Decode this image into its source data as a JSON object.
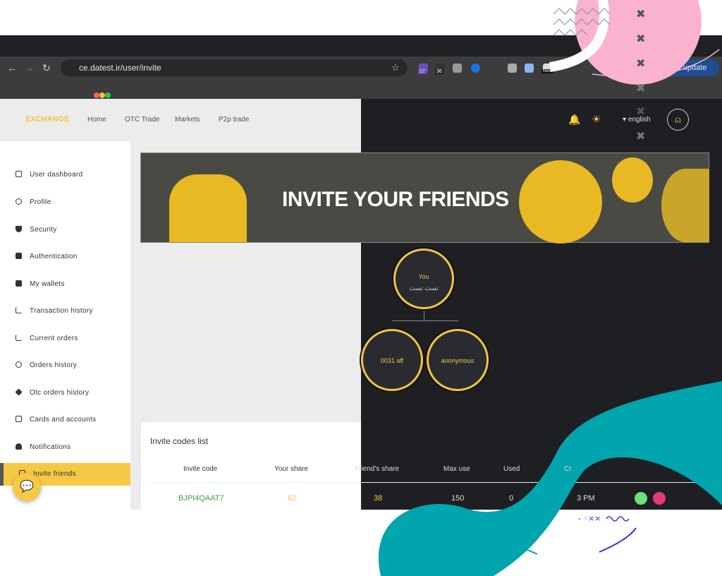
{
  "browser": {
    "url": "ce.datest.ir/user/invite",
    "relaunch": "Relaunch to update",
    "ext_badges": [
      "17",
      "36",
      "New"
    ]
  },
  "header": {
    "logo": "EXCHANGE",
    "menu": [
      "Home",
      "OTC Trade",
      "Markets",
      "P2p trade"
    ],
    "language": "english"
  },
  "sidebar": {
    "items": [
      "User dashboard",
      "Profile",
      "Security",
      "Authentication",
      "My wallets",
      "Transaction history",
      "Current orders",
      "Orders history",
      "Otc orders history",
      "Cards and accounts",
      "Notifications",
      "Invite friends"
    ],
    "active": "Invite friends"
  },
  "banner": {
    "title": "INVITE YOUR FRIENDS"
  },
  "tree": {
    "root": {
      "label": "You",
      "name": "تست تست"
    },
    "children": [
      "0031 aff",
      "anonymous"
    ]
  },
  "table": {
    "title": "Invite codes list",
    "headers": [
      "Invite code",
      "Your share",
      "Friend's share",
      "Max use",
      "Used",
      "Cr"
    ],
    "rows": [
      {
        "code": "BJPI4QAAT7",
        "your_share": "62",
        "friend_share": "38",
        "max_use": "150",
        "used": "0",
        "created": "3 PM"
      }
    ]
  },
  "colors": {
    "accent": "#f6c945",
    "green": "#3e9b4f",
    "teal": "#00a5ad",
    "pink": "#f9b3cf"
  }
}
